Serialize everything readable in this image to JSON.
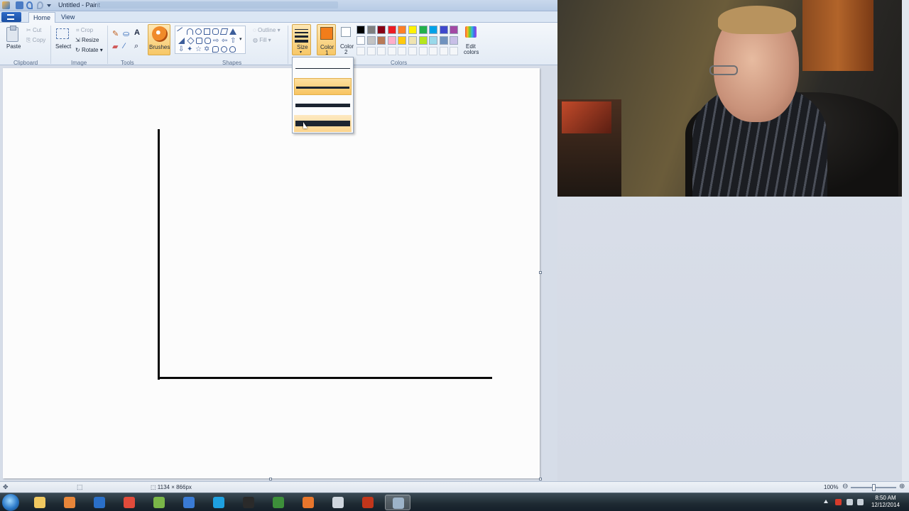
{
  "window": {
    "title": "Untitled - Paint"
  },
  "tabs": [
    {
      "label": "Home"
    },
    {
      "label": "View"
    }
  ],
  "ribbon": {
    "clipboard": {
      "label": "Clipboard",
      "paste": "Paste",
      "cut": "Cut",
      "copy": "Copy"
    },
    "image": {
      "label": "Image",
      "select": "Select",
      "crop": "Crop",
      "resize": "Resize",
      "rotate": "Rotate"
    },
    "tools": {
      "label": "Tools"
    },
    "brushes": {
      "label": "Brushes"
    },
    "shapes": {
      "label": "Shapes",
      "outline": "Outline",
      "fill": "Fill"
    },
    "size": {
      "label": "Size"
    },
    "color1": {
      "label": "Color",
      "sub": "1",
      "value": "#f27d1a"
    },
    "color2": {
      "label": "Color",
      "sub": "2",
      "value": "#ffffff"
    },
    "colors": {
      "label": "Colors"
    },
    "edit_colors": {
      "label": "Edit",
      "sub": "colors"
    }
  },
  "palette": {
    "row1": [
      "#000000",
      "#7f7f7f",
      "#880015",
      "#ed1c24",
      "#ff7f27",
      "#fff200",
      "#22b14c",
      "#00a2e8",
      "#3f48cc",
      "#a349a4"
    ],
    "row2": [
      "#ffffff",
      "#c3c3c3",
      "#b97a57",
      "#ffaec9",
      "#ffc90e",
      "#efe4b0",
      "#b5e61d",
      "#99d9ea",
      "#7092be",
      "#c8bfe7"
    ]
  },
  "size_dropdown": {
    "selected_index": 1,
    "hover_index": 3,
    "options": [
      1,
      3,
      5,
      8
    ]
  },
  "status": {
    "canvas_size": "1134 × 866px",
    "zoom": "100%"
  },
  "taskbar": {
    "apps": [
      "explorer",
      "media-player",
      "photoshop",
      "chrome",
      "notepad-plus-plus",
      "photoshop-alt",
      "skype",
      "winamp",
      "terminal",
      "firefox",
      "camera",
      "media-tool",
      "paint"
    ],
    "time": "8:50 AM",
    "date": "12/12/2014"
  }
}
